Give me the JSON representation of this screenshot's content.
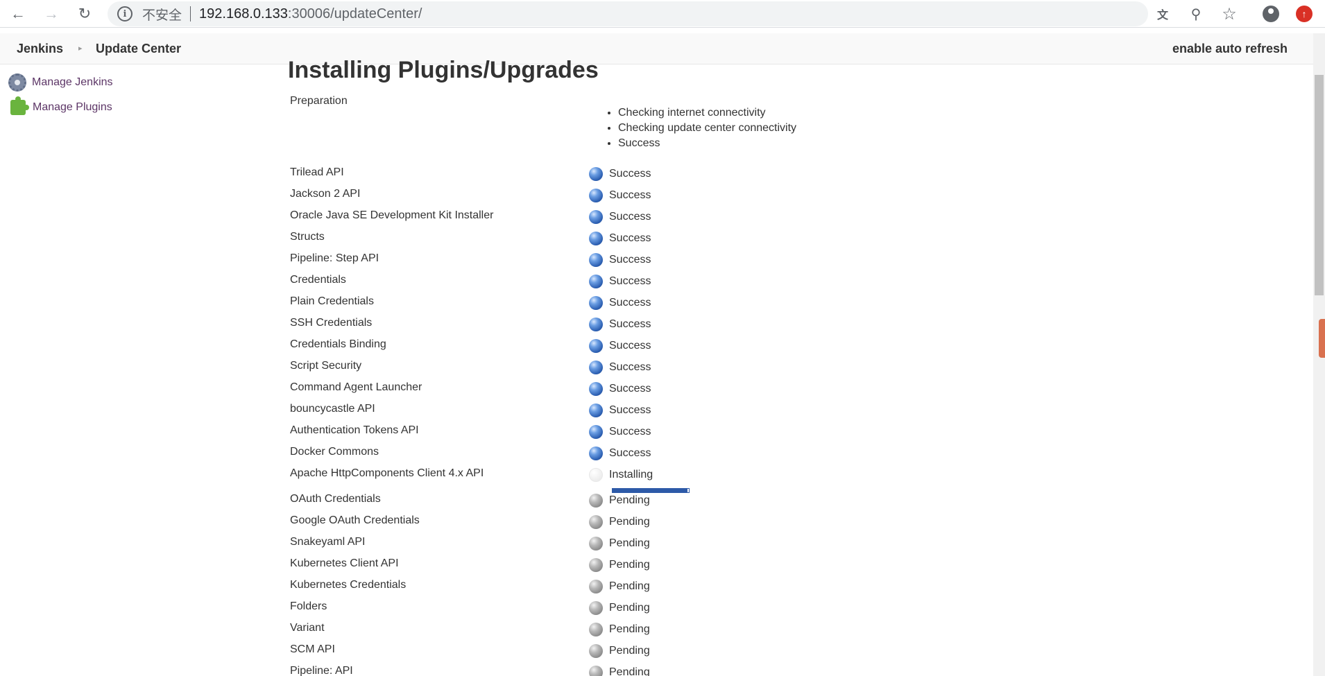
{
  "browser": {
    "insecure_label": "不安全",
    "url_host": "192.168.0.133",
    "url_rest": ":30006/updateCenter/",
    "icons": [
      "back-icon",
      "forward-icon",
      "reload-icon",
      "info-icon",
      "translate-icon",
      "zoom-icon",
      "star-icon",
      "profile-icon",
      "update-icon"
    ]
  },
  "breadcrumb": {
    "root": "Jenkins",
    "current": "Update Center",
    "auto_refresh": "enable auto refresh"
  },
  "sidebar": {
    "items": [
      {
        "label": "Manage Jenkins",
        "icon": "gear-icon"
      },
      {
        "label": "Manage Plugins",
        "icon": "puzzle-icon"
      }
    ]
  },
  "main": {
    "title": "Installing Plugins/Upgrades",
    "preparation": {
      "label": "Preparation",
      "steps": [
        "Checking internet connectivity",
        "Checking update center connectivity",
        "Success"
      ]
    },
    "plugins": [
      {
        "name": "Trilead API",
        "status": "Success",
        "state": "success"
      },
      {
        "name": "Jackson 2 API",
        "status": "Success",
        "state": "success"
      },
      {
        "name": "Oracle Java SE Development Kit Installer",
        "status": "Success",
        "state": "success"
      },
      {
        "name": "Structs",
        "status": "Success",
        "state": "success"
      },
      {
        "name": "Pipeline: Step API",
        "status": "Success",
        "state": "success"
      },
      {
        "name": "Credentials",
        "status": "Success",
        "state": "success"
      },
      {
        "name": "Plain Credentials",
        "status": "Success",
        "state": "success"
      },
      {
        "name": "SSH Credentials",
        "status": "Success",
        "state": "success"
      },
      {
        "name": "Credentials Binding",
        "status": "Success",
        "state": "success"
      },
      {
        "name": "Script Security",
        "status": "Success",
        "state": "success"
      },
      {
        "name": "Command Agent Launcher",
        "status": "Success",
        "state": "success"
      },
      {
        "name": "bouncycastle API",
        "status": "Success",
        "state": "success"
      },
      {
        "name": "Authentication Tokens API",
        "status": "Success",
        "state": "success"
      },
      {
        "name": "Docker Commons",
        "status": "Success",
        "state": "success"
      },
      {
        "name": "Apache HttpComponents Client 4.x API",
        "status": "Installing",
        "state": "installing",
        "progress": 0.98
      },
      {
        "name": "OAuth Credentials",
        "status": "Pending",
        "state": "pending"
      },
      {
        "name": "Google OAuth Credentials",
        "status": "Pending",
        "state": "pending"
      },
      {
        "name": "Snakeyaml API",
        "status": "Pending",
        "state": "pending"
      },
      {
        "name": "Kubernetes Client API",
        "status": "Pending",
        "state": "pending"
      },
      {
        "name": "Kubernetes Credentials",
        "status": "Pending",
        "state": "pending"
      },
      {
        "name": "Folders",
        "status": "Pending",
        "state": "pending"
      },
      {
        "name": "Variant",
        "status": "Pending",
        "state": "pending"
      },
      {
        "name": "SCM API",
        "status": "Pending",
        "state": "pending"
      },
      {
        "name": "Pipeline: API",
        "status": "Pending",
        "state": "pending"
      }
    ]
  },
  "colors": {
    "success": "#2c5fb2",
    "pending": "#8a8a8a",
    "progress": "#2d5aa8",
    "sidebar_link": "#5c3566"
  }
}
